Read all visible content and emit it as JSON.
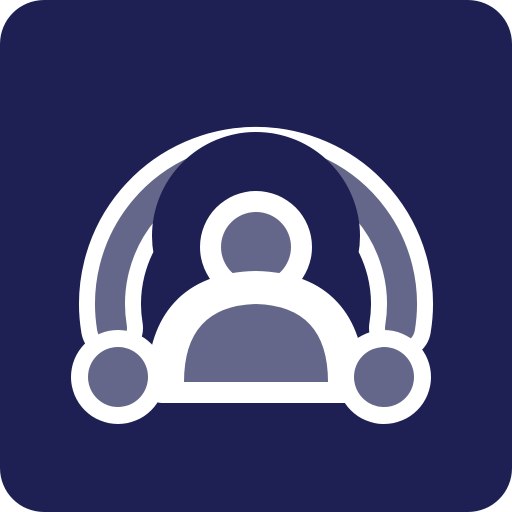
{
  "icon": {
    "name": "podcast-broadcast-person-icon",
    "colors": {
      "tile_background": "#1e1f52",
      "outline": "#ffffff",
      "fill": "#65678a"
    }
  }
}
